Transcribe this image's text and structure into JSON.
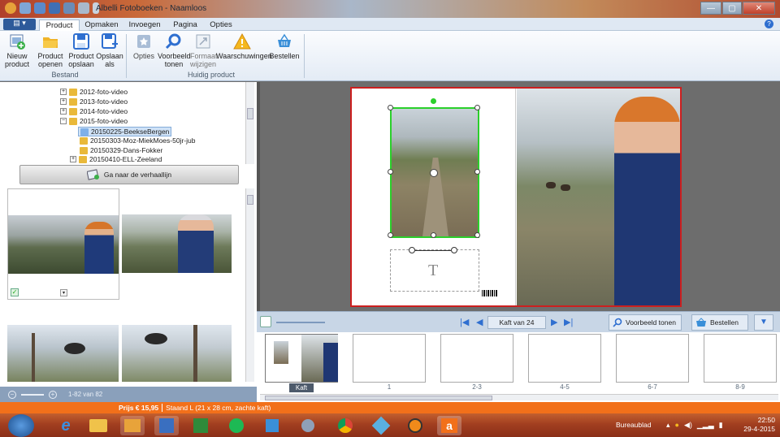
{
  "window": {
    "title": "Albelli Fotoboeken - Naamloos"
  },
  "menu": {
    "file": "▤ ▾",
    "tabs": [
      "Product",
      "Opmaken",
      "Invoegen",
      "Pagina",
      "Opties"
    ],
    "help": "?"
  },
  "ribbon": {
    "buttons": [
      {
        "label": "Nieuw\nproduct",
        "icon": "new-product-icon"
      },
      {
        "label": "Product\nopenen",
        "icon": "open-folder-icon"
      },
      {
        "label": "Product\nopslaan",
        "icon": "save-icon"
      },
      {
        "label": "Opslaan\nals",
        "icon": "save-as-icon"
      },
      {
        "label": "Opties",
        "icon": "options-icon"
      },
      {
        "label": "Voorbeeld\ntonen",
        "icon": "preview-search-icon"
      },
      {
        "label": "Formaat\nwijzigen",
        "icon": "resize-icon"
      },
      {
        "label": "Waarschuwingen",
        "icon": "warning-icon"
      },
      {
        "label": "Bestellen",
        "icon": "basket-icon"
      }
    ],
    "groups": [
      "Bestand",
      "Huidig product"
    ]
  },
  "tree": {
    "items": [
      "2012-foto-video",
      "2013-foto-video",
      "2014-foto-video",
      "2015-foto-video",
      "20150225-BeekseBergen",
      "20150303-Moz-MiekMoes-50jr-jub",
      "20150329-Dans-Fokker",
      "20150410-ELL-Zeeland"
    ],
    "selected": "20150225-BeekseBergen"
  },
  "story_button": "Ga naar de verhaallijn",
  "photo_count": "1-82 van 82",
  "navbar": {
    "page_indicator": "Kaft van 24",
    "preview": "Voorbeeld tonen",
    "order": "Bestellen"
  },
  "pages": [
    "Kaft",
    "1",
    "2-3",
    "4-5",
    "6-7",
    "8-9"
  ],
  "status": {
    "price": "Prijs € 15,95",
    "format": "Staand L (21 x 28 cm, zachte kaft)"
  },
  "taskbar": {
    "desktop": "Bureaublad",
    "time": "22:50",
    "date": "29-4-2015"
  },
  "colors": {
    "accent": "#f2701a",
    "selection": "#2bd02b",
    "spread_border": "#cc1f1f"
  }
}
